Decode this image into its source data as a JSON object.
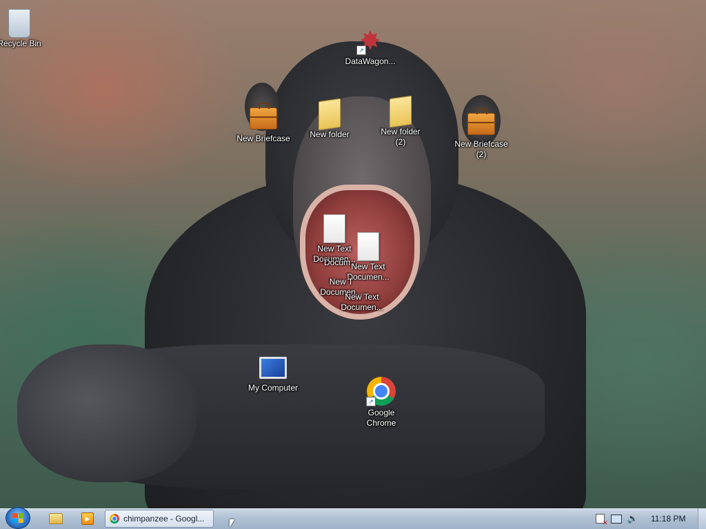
{
  "desktop": {
    "wallpaper_subject": "chimpanzee",
    "icons": {
      "recycle_bin": "Recycle Bin",
      "datawagon": "DataWagon...",
      "new_briefcase": "New Briefcase",
      "new_folder": "New folder",
      "new_folder_2": "New folder\n(2)",
      "new_briefcase_2": "New Briefcase\n(2)",
      "text_doc_1": "New Text\nDocumen...",
      "text_doc_2": "New Text\nDocumen...",
      "text_doc_3": "New T\nDocumen...",
      "text_doc_4": "New Text\nDocumen...",
      "text_doc_overlap": "Docum...",
      "my_computer": "My Computer",
      "google_chrome": "Google\nChrome"
    }
  },
  "taskbar": {
    "chrome_task_label": "chimpanzee - Googl...",
    "clock": "11:18 PM"
  },
  "colors": {
    "taskbar_top": "#c9d6e4",
    "taskbar_bottom": "#9fb2c7",
    "icon_label_text": "#ffffff",
    "datawagon_red": "#c0353b"
  }
}
